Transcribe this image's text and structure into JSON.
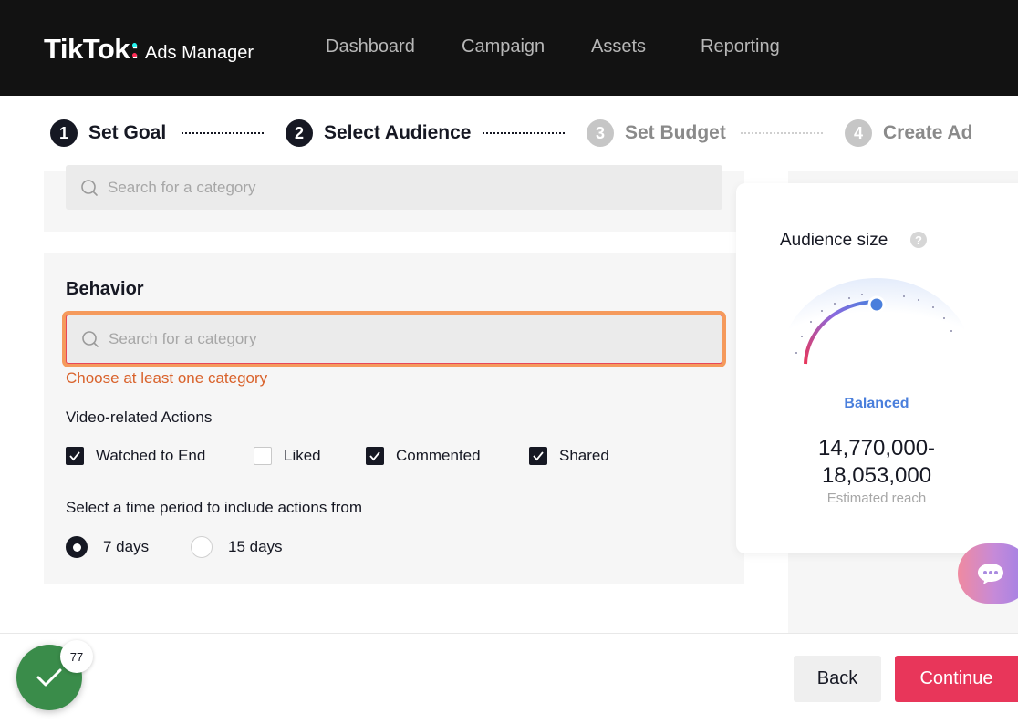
{
  "header": {
    "logo_main": "TikTok",
    "logo_sub": "Ads Manager",
    "nav": [
      "Dashboard",
      "Campaign",
      "Assets",
      "Reporting"
    ]
  },
  "steps": [
    {
      "num": "1",
      "label": "Set Goal",
      "state": "done"
    },
    {
      "num": "2",
      "label": "Select Audience",
      "state": "active"
    },
    {
      "num": "3",
      "label": "Set Budget",
      "state": "inactive"
    },
    {
      "num": "4",
      "label": "Create Ad",
      "state": "inactive"
    }
  ],
  "top_search": {
    "placeholder": "Search for a category"
  },
  "behavior": {
    "title": "Behavior",
    "search_placeholder": "Search for a category",
    "error": "Choose at least one category",
    "video_actions_label": "Video-related Actions",
    "actions": [
      {
        "label": "Watched to End",
        "checked": true
      },
      {
        "label": "Liked",
        "checked": false
      },
      {
        "label": "Commented",
        "checked": true
      },
      {
        "label": "Shared",
        "checked": true
      }
    ],
    "period_label": "Select a time period to include actions from",
    "periods": [
      {
        "label": "7 days",
        "selected": true
      },
      {
        "label": "15 days",
        "selected": false
      }
    ]
  },
  "audience": {
    "title": "Audience size",
    "help": "?",
    "status": "Balanced",
    "reach_line1": "14,770,000-",
    "reach_line2": "18,053,000",
    "reach_label": "Estimated reach"
  },
  "footer": {
    "back": "Back",
    "continue": "Continue",
    "badge_count": "77"
  },
  "colors": {
    "accent": "#e8365a",
    "error": "#d9622b",
    "balanced": "#4a7fdc",
    "status_green": "#3a8c4a"
  }
}
